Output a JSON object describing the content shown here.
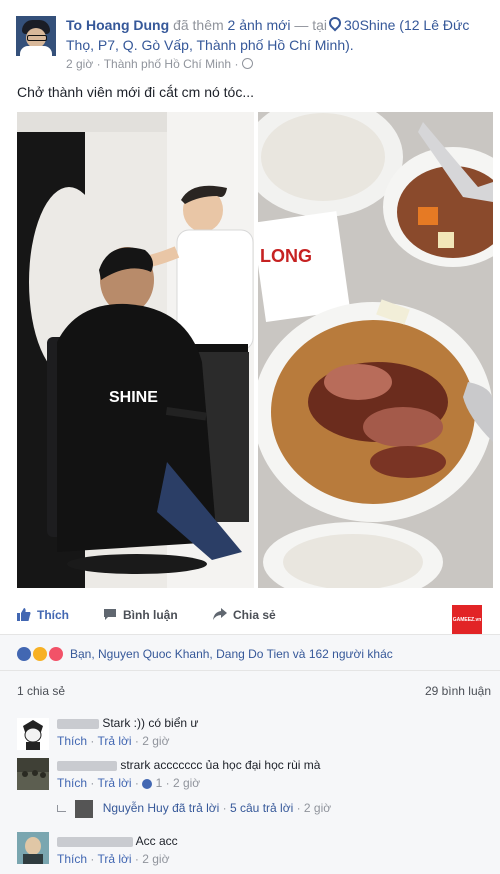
{
  "post": {
    "author": "To Hoang Dung",
    "verb": "đã thêm",
    "photos_count": "2 ảnh mới",
    "dash": "—",
    "at": "tại",
    "place": "30Shine (12 Lê Đức Thọ, P7, Q. Gò Vấp, Thành phố Hồ Chí Minh).",
    "time": "2 giờ",
    "location": "Thành phố Hồ Chí Minh",
    "separator": "·",
    "caption": "Chở thành viên mới đi cắt cm nó tóc..."
  },
  "actions": {
    "like": "Thích",
    "comment": "Bình luận",
    "share": "Chia sẻ",
    "badge": "GAMEEZ.vn"
  },
  "reactions": {
    "text": "Bạn, Nguyen Quoc Khanh, Dang Do Tien và 162 người khác",
    "colors": {
      "like": "#4267b2",
      "haha": "#f7b125",
      "love": "#f25268"
    }
  },
  "stats": {
    "shares": "1 chia sẻ",
    "comments": "29 bình luận"
  },
  "comments": [
    {
      "text": "Stark :)) có biển ư",
      "like": "Thích",
      "reply": "Trả lời",
      "time": "2 giờ"
    },
    {
      "text": "strark accccccc ủa học đại học rùi mà",
      "like": "Thích",
      "reply": "Trả lời",
      "likes": "1",
      "time": "2 giờ"
    },
    {
      "text": "Acc acc",
      "like": "Thích",
      "reply": "Trả lời",
      "time": "2 giờ"
    }
  ],
  "reply_summary": {
    "name": "Nguyễn Huy",
    "action": "đã trả lời",
    "count": "5 câu trả lời",
    "time": "2 giờ"
  }
}
